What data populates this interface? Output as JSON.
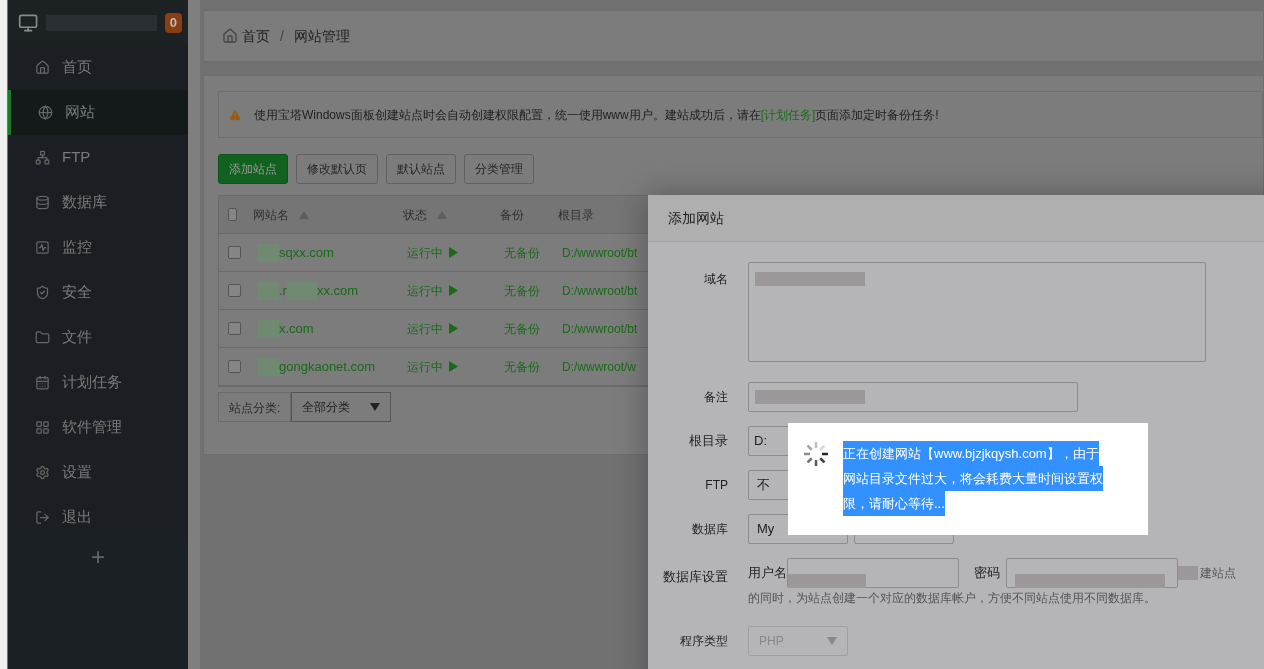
{
  "sidebar": {
    "badge": "0",
    "items": [
      {
        "label": "首页",
        "selected": false
      },
      {
        "label": "网站",
        "selected": true
      },
      {
        "label": "FTP",
        "selected": false
      },
      {
        "label": "数据库",
        "selected": false
      },
      {
        "label": "监控",
        "selected": false
      },
      {
        "label": "安全",
        "selected": false
      },
      {
        "label": "文件",
        "selected": false
      },
      {
        "label": "计划任务",
        "selected": false
      },
      {
        "label": "软件管理",
        "selected": false
      },
      {
        "label": "设置",
        "selected": false
      },
      {
        "label": "退出",
        "selected": false
      }
    ],
    "add_button": "+"
  },
  "breadcrumb": {
    "items": [
      "首页",
      "网站管理"
    ],
    "separator": "/"
  },
  "alert": {
    "text_before": "使用宝塔Windows面板创建站点时会自动创建权限配置，统一使用www用户。建站成功后，请在",
    "link": "[计划任务]",
    "text_after": "页面添加定时备份任务!"
  },
  "toolbar": [
    {
      "label": "添加站点",
      "kind": "primary"
    },
    {
      "label": "修改默认页",
      "kind": "default"
    },
    {
      "label": "默认站点",
      "kind": "default"
    },
    {
      "label": "分类管理",
      "kind": "default"
    }
  ],
  "table": {
    "all_checked": false,
    "columns": [
      {
        "label": "网站名",
        "sortable": true
      },
      {
        "label": "状态",
        "sortable": true
      },
      {
        "label": "备份",
        "sortable": false
      },
      {
        "label": "根目录",
        "sortable": false
      }
    ],
    "rows": [
      {
        "checked": false,
        "name_parts": [
          "sqxx.com"
        ],
        "status": "运行中",
        "backup": "无备份",
        "root": "D:/wwwroot/bt"
      },
      {
        "checked": false,
        "name_parts": [
          ".r",
          "xx.com"
        ],
        "status": "运行中",
        "backup": "无备份",
        "root": "D:/wwwroot/bt"
      },
      {
        "checked": false,
        "name_parts": [
          "x.com"
        ],
        "status": "运行中",
        "backup": "无备份",
        "root": "D:/wwwroot/bt"
      },
      {
        "checked": false,
        "name_parts": [
          "gongkaonet.com"
        ],
        "status": "运行中",
        "backup": "无备份",
        "root": "D:/wwwroot/w"
      }
    ]
  },
  "filter": {
    "label": "站点分类:",
    "value": "全部分类"
  },
  "modal": {
    "title": "添加网站",
    "domain_label": "域名",
    "note_label": "备注",
    "root_label": "根目录",
    "root_value": "D:",
    "ftp_label": "FTP",
    "ftp_value": "不",
    "database_label": "数据库",
    "database_value": "My",
    "db_settings_label": "数据库设置",
    "username_label": "用户名",
    "password_label": "密码",
    "db_hint_lines": [
      "建站点",
      "的同时，为站点创建一个对应的数据库帐户，方便不同站点使用不同数据库。"
    ],
    "program_label": "程序类型",
    "program_value": "PHP",
    "program_disabled": true
  },
  "toast": {
    "message_lines": [
      "正在创建网站【www.bjzjkqysh.com】，由于",
      "网站目录文件过大，将会耗费大量时间设置权",
      "限，请耐心等待..."
    ],
    "highlighted": true
  }
}
